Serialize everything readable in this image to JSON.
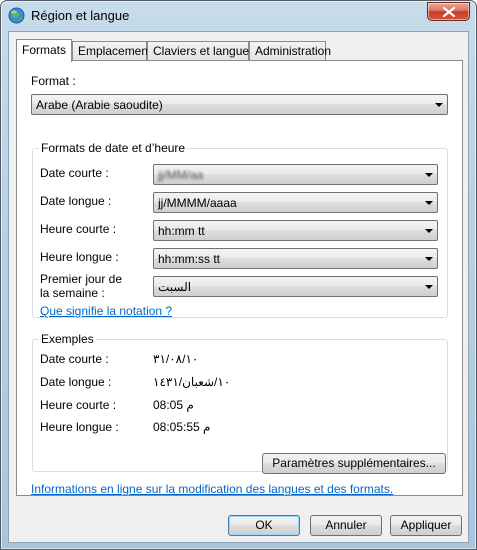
{
  "window": {
    "title": "Région et langue"
  },
  "tabs": [
    {
      "label": "Formats"
    },
    {
      "label": "Emplacement"
    },
    {
      "label": "Claviers et langues"
    },
    {
      "label": "Administration"
    }
  ],
  "format": {
    "label": "Format :",
    "value": "Arabe (Arabie saoudite)"
  },
  "date_time_group": {
    "title": "Formats de date et d’heure",
    "short_date": {
      "label": "Date courte :",
      "value": "jj/MM/aa"
    },
    "long_date": {
      "label": "Date longue :",
      "value": "jj/MMMM/aaaa"
    },
    "short_time": {
      "label": "Heure courte :",
      "value": "hh:mm tt"
    },
    "long_time": {
      "label": "Heure longue :",
      "value": "hh:mm:ss tt"
    },
    "first_day": {
      "label_line1": "Premier jour de",
      "label_line2": "la semaine :",
      "value": "السبت"
    }
  },
  "notation_link": "Que signifie la notation ?",
  "examples": {
    "title": "Exemples",
    "short_date": {
      "label": "Date courte :",
      "value": "٣١/٠٨/١٠"
    },
    "long_date": {
      "label": "Date longue :",
      "value": "١٠/شعبان/١٤٣١"
    },
    "short_time": {
      "label": "Heure courte :",
      "value": "08:05 م"
    },
    "long_time": {
      "label": "Heure longue :",
      "value": "08:05:55 م"
    }
  },
  "additional_button": "Paramètres supplémentaires...",
  "online_info_link": "Informations en ligne sur la modification des langues et des formats.",
  "buttons": {
    "ok": "OK",
    "cancel": "Annuler",
    "apply": "Appliquer"
  },
  "icons": {
    "title": "globe-icon",
    "close": "close-icon"
  }
}
